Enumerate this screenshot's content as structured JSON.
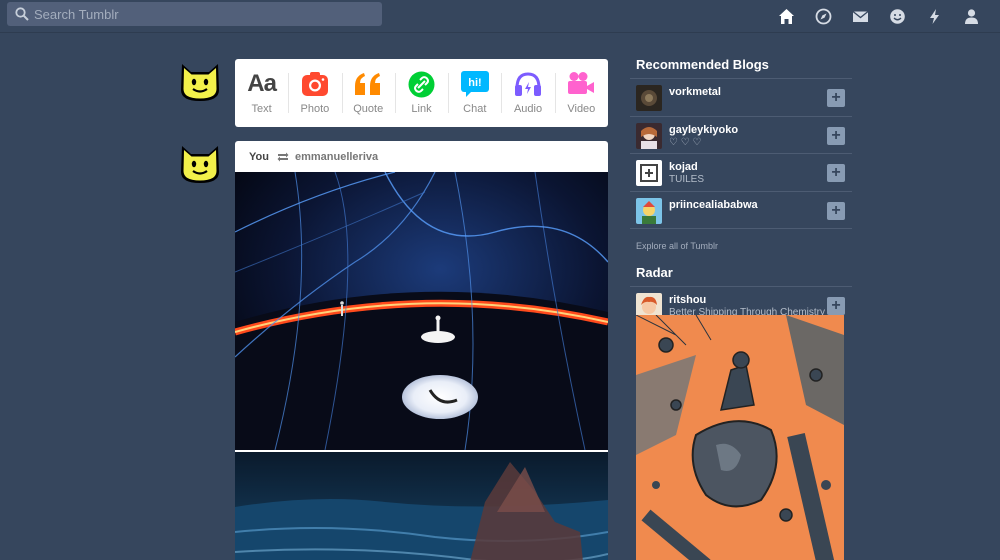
{
  "header": {
    "search_placeholder": "Search Tumblr",
    "icons": [
      "home-icon",
      "explore-icon",
      "inbox-icon",
      "messaging-icon",
      "activity-icon",
      "account-icon"
    ]
  },
  "post_types": [
    {
      "label": "Text",
      "icon": "text-icon",
      "glyph": "Aa",
      "color": "#444444"
    },
    {
      "label": "Photo",
      "icon": "camera-icon",
      "color": "#ff492f"
    },
    {
      "label": "Quote",
      "icon": "quote-icon",
      "color": "#ff8a00"
    },
    {
      "label": "Link",
      "icon": "link-icon",
      "color": "#00cf35"
    },
    {
      "label": "Chat",
      "icon": "chat-icon",
      "glyph": "hi!",
      "color": "#00b8ff"
    },
    {
      "label": "Audio",
      "icon": "headphones-icon",
      "color": "#7c5cff"
    },
    {
      "label": "Video",
      "icon": "video-icon",
      "color": "#ff62ce"
    }
  ],
  "post": {
    "author": "You",
    "reblogged_from": "emmanuelleriva"
  },
  "sidebar": {
    "recommended_title": "Recommended Blogs",
    "blogs": [
      {
        "name": "vorkmetal",
        "subtitle": ""
      },
      {
        "name": "gayleykiyoko",
        "subtitle": "♡ ♡ ♡"
      },
      {
        "name": "kojad",
        "subtitle": "TUILES"
      },
      {
        "name": "priincealiababwa",
        "subtitle": ""
      }
    ],
    "explore_link": "Explore all of Tumblr",
    "radar_title": "Radar",
    "radar_blog": {
      "name": "ritshou",
      "subtitle": "Better Shipping Through Chemistry"
    }
  },
  "colors": {
    "background": "#36465d",
    "card": "#ffffff",
    "follow_button": "#889bb3"
  }
}
